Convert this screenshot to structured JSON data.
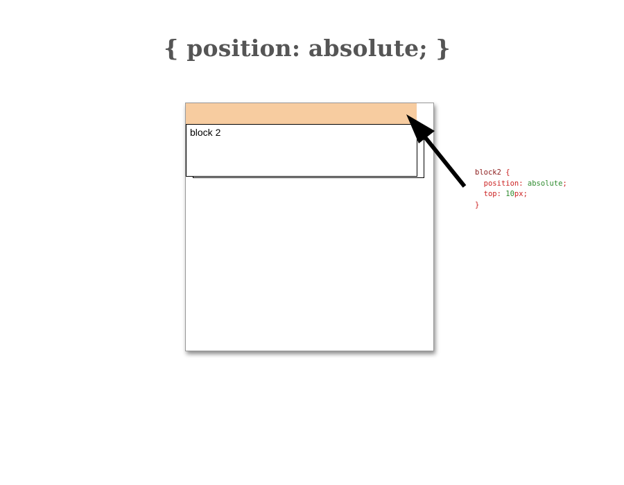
{
  "slide": {
    "title": "{ position: absolute; }"
  },
  "demo": {
    "block2_label": "block 2",
    "colors": {
      "block1_fill": "#f7cca0",
      "block_border": "#000000",
      "arrow": "#000000"
    }
  },
  "code": {
    "selector": "block2",
    "open_brace": " {",
    "rule1_property": "position:",
    "rule1_value": " absolute",
    "rule1_end": ";",
    "rule2_property": "top:",
    "rule2_number": " 10",
    "rule2_unit": "px",
    "rule2_end": ";",
    "close_brace": "}",
    "colors": {
      "selector": "#8b1a1a",
      "property": "#cc2222",
      "value": "#2e8b2e"
    }
  }
}
